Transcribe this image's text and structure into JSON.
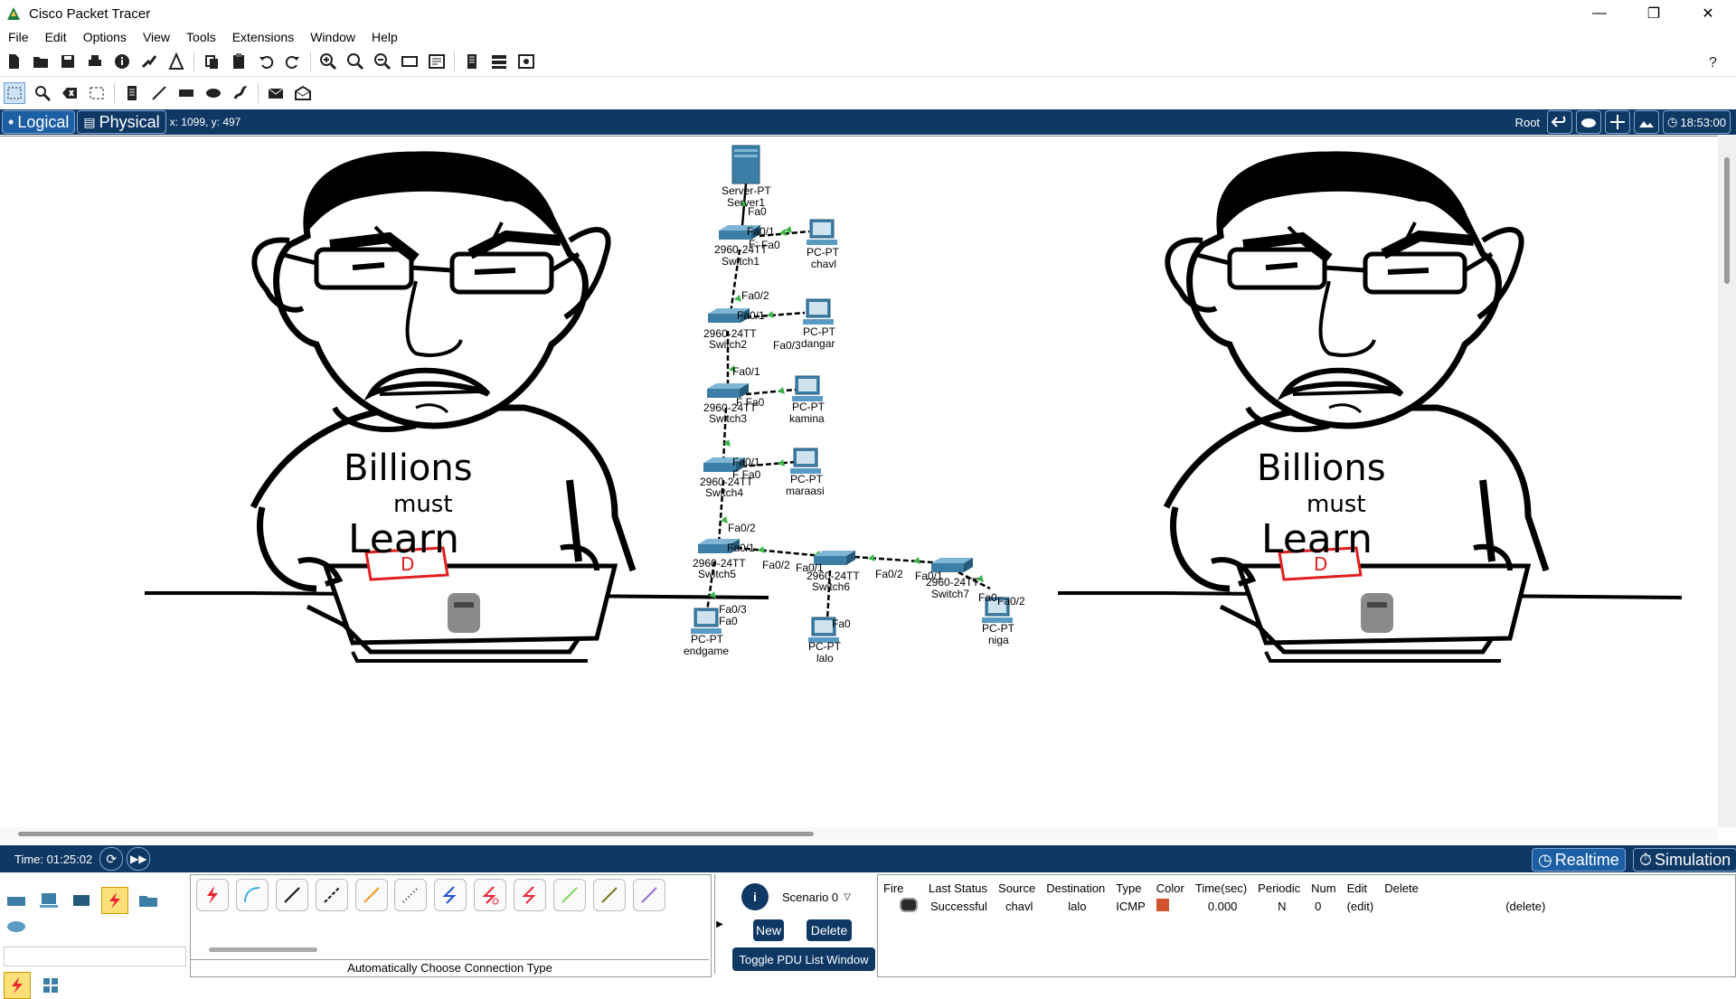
{
  "window": {
    "title": "Cisco Packet Tracer",
    "controls": [
      "—",
      "❐",
      "✕"
    ]
  },
  "menu": [
    "File",
    "Edit",
    "Options",
    "View",
    "Tools",
    "Extensions",
    "Window",
    "Help"
  ],
  "nav": {
    "logical": "Logical",
    "physical": "Physical",
    "coords": "x: 1099, y: 497",
    "root": "Root",
    "clock": "18:53:00"
  },
  "meme": {
    "line1": "Billions",
    "line2": "must",
    "line3": "Learn",
    "laptop_logo": "D"
  },
  "topology": {
    "server": {
      "model": "Server-PT",
      "name": "Server1",
      "port": "Fa0"
    },
    "switches": [
      {
        "model": "2960-24TT",
        "name": "Switch1"
      },
      {
        "model": "2960-24TT",
        "name": "Switch2"
      },
      {
        "model": "2960-24TT",
        "name": "Switch3"
      },
      {
        "model": "2960-24TT",
        "name": "Switch4"
      },
      {
        "model": "2960-24TT",
        "name": "Switch5"
      },
      {
        "model": "2960-24TT",
        "name": "Switch6"
      },
      {
        "model": "2960-24TT",
        "name": "Switch7"
      }
    ],
    "pcs": [
      {
        "model": "PC-PT",
        "name": "chavl"
      },
      {
        "model": "PC-PT",
        "name": "dangar"
      },
      {
        "model": "PC-PT",
        "name": "kamina"
      },
      {
        "model": "PC-PT",
        "name": "maraasi"
      },
      {
        "model": "PC-PT",
        "name": "endgame"
      },
      {
        "model": "PC-PT",
        "name": "lalo"
      },
      {
        "model": "PC-PT",
        "name": "niga"
      }
    ],
    "ports": [
      "Fa0/1",
      "Fa0",
      "Fa0/2",
      "Fa0/1",
      "Fa0/3",
      "Fa0/1",
      "Fa0",
      "Fa0/1",
      "Fa0",
      "Fa0/2",
      "Fa0/1",
      "Fa0/2",
      "Fa0/1",
      "Fa0/3",
      "Fa0",
      "Fa0/2",
      "Fa0/1",
      "Fa0",
      "Fa0/2",
      "Fa0/3",
      "Fa0/1",
      "F",
      "F:",
      "F Fa0"
    ]
  },
  "status": {
    "time": "Time: 01:25:02",
    "realtime": "Realtime",
    "simulation": "Simulation"
  },
  "connections_label": "Automatically Choose Connection Type",
  "scenario": {
    "info": "i",
    "selected": "Scenario 0",
    "new": "New",
    "delete": "Delete",
    "toggle": "Toggle PDU List Window"
  },
  "pdu": {
    "headers": [
      "Fire",
      "Last Status",
      "Source",
      "Destination",
      "Type",
      "Color",
      "Time(sec)",
      "Periodic",
      "Num",
      "Edit",
      "Delete"
    ],
    "rows": [
      {
        "status": "Successful",
        "source": "chavl",
        "destination": "lalo",
        "type": "ICMP",
        "color": "#d2522c",
        "time": "0.000",
        "periodic": "N",
        "num": "0",
        "edit": "(edit)",
        "delete": "(delete)"
      }
    ]
  },
  "colors": {
    "nav_bg": "#0f3864",
    "link_green": "#3cb54a",
    "device_blue": "#3d7ea6"
  }
}
